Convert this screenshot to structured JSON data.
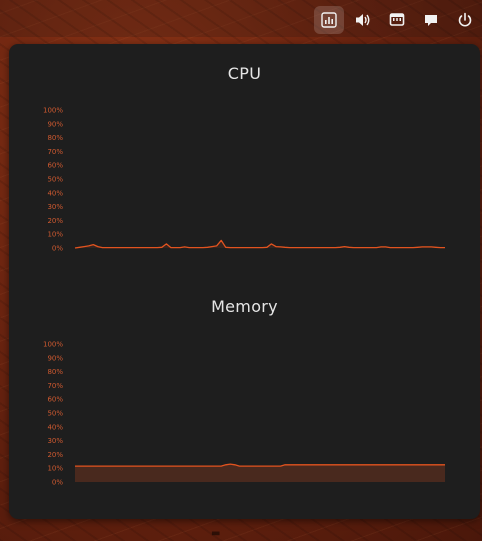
{
  "topbar": {
    "indicators": [
      {
        "icon": "system-monitor-icon",
        "active": true
      },
      {
        "icon": "volume-icon",
        "active": false
      },
      {
        "icon": "network-icon",
        "active": false
      },
      {
        "icon": "chat-icon",
        "active": false
      },
      {
        "icon": "power-icon",
        "active": false
      }
    ]
  },
  "panel": {
    "accent_color": "#e2531f",
    "charts": [
      {
        "id": "cpu",
        "title": "CPU"
      },
      {
        "id": "memory",
        "title": "Memory"
      }
    ]
  },
  "chart_data": [
    {
      "type": "area",
      "title": "CPU",
      "y_ticks": [
        "100%",
        "90%",
        "80%",
        "70%",
        "60%",
        "50%",
        "40%",
        "30%",
        "20%",
        "10%",
        "0%"
      ],
      "ylim": [
        0,
        100
      ],
      "y_unit": "%",
      "grid": false,
      "values": [
        0,
        0.5,
        1,
        1.5,
        2.5,
        1,
        0.3,
        0.3,
        0.3,
        0.3,
        0.3,
        0.3,
        0.3,
        0.3,
        0.3,
        0.3,
        0.3,
        0.3,
        0.3,
        0.5,
        3,
        0.3,
        0.3,
        0.3,
        0.8,
        0.3,
        0.3,
        0.3,
        0.3,
        0.5,
        1,
        1.5,
        5.5,
        0.5,
        0.3,
        0.3,
        0.3,
        0.3,
        0.3,
        0.3,
        0.3,
        0.3,
        0.5,
        3,
        1,
        0.8,
        0.5,
        0.3,
        0.3,
        0.3,
        0.3,
        0.3,
        0.3,
        0.3,
        0.3,
        0.3,
        0.3,
        0.3,
        0.5,
        1,
        0.5,
        0.3,
        0.3,
        0.3,
        0.3,
        0.3,
        0.3,
        0.8,
        0.8,
        0.3,
        0.3,
        0.3,
        0.3,
        0.3,
        0.3,
        0.5,
        0.8,
        0.8,
        0.8,
        0.5,
        0.3,
        0.3
      ]
    },
    {
      "type": "area",
      "title": "Memory",
      "y_ticks": [
        "100%",
        "90%",
        "80%",
        "70%",
        "60%",
        "50%",
        "40%",
        "30%",
        "20%",
        "10%",
        "0%"
      ],
      "ylim": [
        0,
        100
      ],
      "y_unit": "%",
      "grid": false,
      "values": [
        11.5,
        11.5,
        11.5,
        11.5,
        11.5,
        11.5,
        11.5,
        11.5,
        11.5,
        11.5,
        11.5,
        11.5,
        11.5,
        11.5,
        11.5,
        11.5,
        11.5,
        11.5,
        11.5,
        11.5,
        11.5,
        11.5,
        11.5,
        11.5,
        11.5,
        11.5,
        11.5,
        11.5,
        11.5,
        11.5,
        11.5,
        11.5,
        11.5,
        12.5,
        13,
        12.5,
        11.5,
        11.5,
        11.5,
        11.5,
        11.5,
        11.5,
        11.5,
        11.5,
        11.5,
        11.5,
        12.5,
        12.5,
        12.5,
        12.5,
        12.5,
        12.5,
        12.5,
        12.5,
        12.5,
        12.5,
        12.5,
        12.5,
        12.5,
        12.5,
        12.5,
        12.5,
        12.5,
        12.5,
        12.5,
        12.5,
        12.5,
        12.5,
        12.5,
        12.5,
        12.5,
        12.5,
        12.5,
        12.5,
        12.5,
        12.5,
        12.5,
        12.5,
        12.5,
        12.5,
        12.5,
        12.5
      ]
    }
  ]
}
